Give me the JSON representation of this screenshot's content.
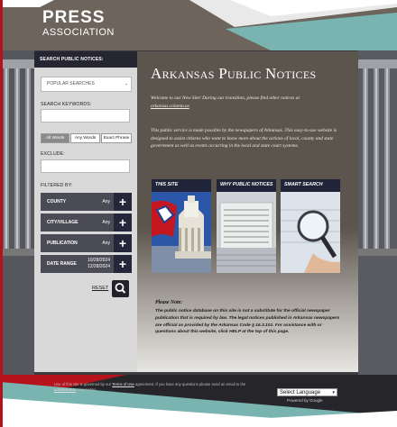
{
  "brand": {
    "line1": "PRESS",
    "line2": "ASSOCIATION"
  },
  "sidebar": {
    "header": "SEARCH PUBLIC NOTICES:",
    "popular_select": "POPULAR SEARCHES",
    "keywords_label": "SEARCH KEYWORDS:",
    "match_modes": [
      "All Words",
      "Any Words",
      "Exact Phrase"
    ],
    "exclude_label": "EXCLUDE:",
    "filtered_label": "FILTERED BY:",
    "filters": [
      {
        "name": "COUNTY",
        "value": "Any"
      },
      {
        "name": "CITY/VILLAGE",
        "value": "Any"
      },
      {
        "name": "PUBLICATION",
        "value": "Any"
      },
      {
        "name": "DATE RANGE",
        "value": "10/28/2024",
        "value2": "12/28/2024"
      }
    ],
    "reset_label": "RESET"
  },
  "main": {
    "title": "Arkansas Public Notices",
    "intro1": "Welcome to our New Site! During our transition, please find other notices at",
    "intro1_link": "arkansas.column.us",
    "intro2": "This public service is made possible by the newspapers of Arkansas. This easy-to-use website is designed to assist citizens who want to know more about the actions of local, county and state government as well as events occurring in the local and state court systems.",
    "cards": [
      "THIS SITE",
      "WHY PUBLIC NOTICES",
      "SMART SEARCH"
    ],
    "note_title": "Please Note:",
    "note_body": "The public notice database on this site is not a substitute for the official newspaper publication that is required by law. The legal notices published in Arkansas newspapers are official as provided by the Arkansas Code § 16.3.101. For assistance with or questions about this website, click HELP at the top of this page."
  },
  "footer": {
    "text_a": "Use of this site is governed by our",
    "terms": "Terms of Use",
    "text_b": "agreement. If you have any questions please send an email to the",
    "admin": "administrator",
    "text_c": "Association.",
    "language_select": "Select Language",
    "powered": "Powered by Google"
  },
  "colors": {
    "accent_teal": "#79b4b0",
    "navy": "#262633",
    "brown": "#5b544c",
    "red": "#b5121b"
  }
}
